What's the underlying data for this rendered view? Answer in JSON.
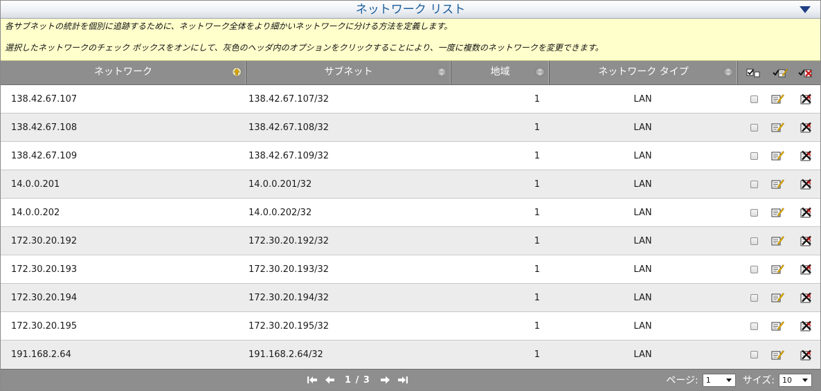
{
  "header": {
    "title": "ネットワーク リスト"
  },
  "info": {
    "line1": "各サブネットの統計を個別に追跡するために、ネットワーク全体をより細かいネットワークに分ける方法を定義します。",
    "line2": "選択したネットワークのチェック ボックスをオンにして、灰色のヘッダ内のオプションをクリックすることにより、一度に複数のネットワークを変更できます。"
  },
  "columns": {
    "network": "ネットワーク",
    "subnet": "サブネット",
    "region": "地域",
    "type": "ネットワーク タイプ"
  },
  "rows": [
    {
      "network": "138.42.67.107",
      "subnet": "138.42.67.107/32",
      "region": "1",
      "type": "LAN"
    },
    {
      "network": "138.42.67.108",
      "subnet": "138.42.67.108/32",
      "region": "1",
      "type": "LAN"
    },
    {
      "network": "138.42.67.109",
      "subnet": "138.42.67.109/32",
      "region": "1",
      "type": "LAN"
    },
    {
      "network": "14.0.0.201",
      "subnet": "14.0.0.201/32",
      "region": "1",
      "type": "LAN"
    },
    {
      "network": "14.0.0.202",
      "subnet": "14.0.0.202/32",
      "region": "1",
      "type": "LAN"
    },
    {
      "network": "172.30.20.192",
      "subnet": "172.30.20.192/32",
      "region": "1",
      "type": "LAN"
    },
    {
      "network": "172.30.20.193",
      "subnet": "172.30.20.193/32",
      "region": "1",
      "type": "LAN"
    },
    {
      "network": "172.30.20.194",
      "subnet": "172.30.20.194/32",
      "region": "1",
      "type": "LAN"
    },
    {
      "network": "172.30.20.195",
      "subnet": "172.30.20.195/32",
      "region": "1",
      "type": "LAN"
    },
    {
      "network": "191.168.2.64",
      "subnet": "191.168.2.64/32",
      "region": "1",
      "type": "LAN"
    }
  ],
  "footer": {
    "page_info": "1 / 3",
    "page_label": "ページ:",
    "page_value": "1",
    "size_label": "サイズ:",
    "size_value": "10"
  },
  "icons": {
    "collapse": "triangle-down-icon",
    "sort_active": "sort-ascending-icon",
    "sort_inactive": "sort-neutral-icon",
    "select_all": "select-all-checkbox-icon",
    "edit_selected": "edit-selected-icon",
    "delete_selected": "delete-selected-icon",
    "edit": "edit-icon",
    "delete": "delete-icon",
    "first": "first-page-icon",
    "prev": "previous-page-icon",
    "next": "next-page-icon",
    "last": "last-page-icon"
  },
  "colors": {
    "title": "#1b5e9c",
    "info_bg": "#ffffcc",
    "header_bg": "#8e8e8e",
    "alt_row": "#ececec",
    "edit_yellow": "#e8b400",
    "delete_red": "#cc1a1a"
  }
}
